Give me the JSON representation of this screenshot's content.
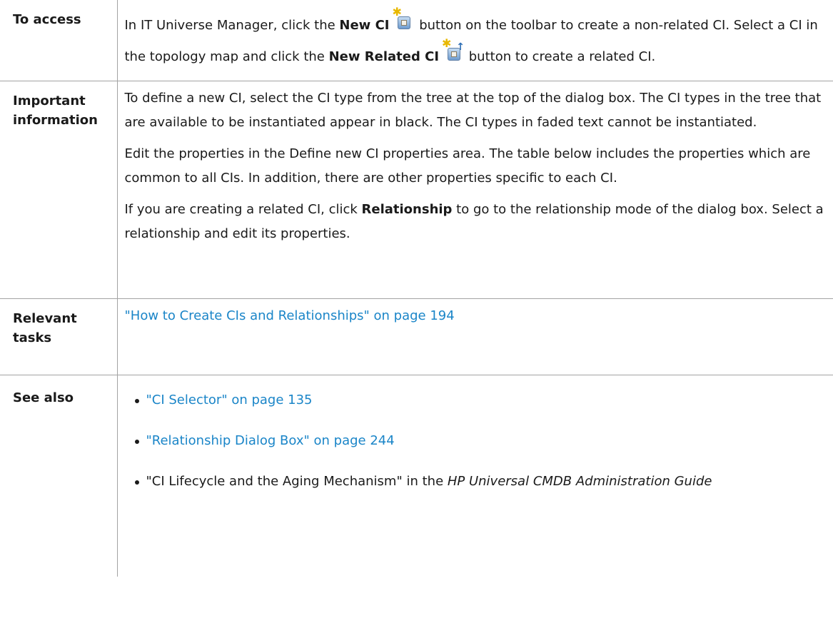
{
  "rows": {
    "access": {
      "label": "To access",
      "text": {
        "part1": "In IT Universe Manager, click the ",
        "new_ci": "New CI",
        "part2": " button on the toolbar to create a non-related CI. Select a CI in the topology map and click the ",
        "new_related_ci": "New Related CI",
        "part3": " button to create a related CI."
      },
      "icons": [
        "new-ci-icon",
        "new-related-ci-icon"
      ]
    },
    "important": {
      "label": "Important information",
      "paragraphs": [
        "To define a new CI, select the CI type from the tree at the top of the dialog box. The CI types in the tree that are available to be instantiated appear in black. The CI types in faded text cannot be instantiated.",
        "Edit the properties in the Define new CI properties area. The table below includes the properties which are common to all CIs. In addition, there are other properties specific to each CI."
      ],
      "relationship_para": {
        "before": "If you are creating a related CI, click ",
        "bold": "Relationship",
        "after": " to go to the relationship mode of the dialog box. Select a relationship and edit its properties."
      }
    },
    "relevant": {
      "label": "Relevant tasks",
      "link": "\"How to Create CIs and Relationships\" on page 194"
    },
    "see_also": {
      "label": "See also",
      "link1": "\"CI Selector\" on page 135",
      "link2": "\"Relationship Dialog Box\" on page 244",
      "item3": {
        "before": "\"CI Lifecycle and the Aging Mechanism\" in the ",
        "italic": "HP Universal CMDB Administration Guide"
      }
    }
  },
  "colors": {
    "link": "#1a85c8",
    "border": "#a3a3a3",
    "text": "#1a1a1a"
  }
}
